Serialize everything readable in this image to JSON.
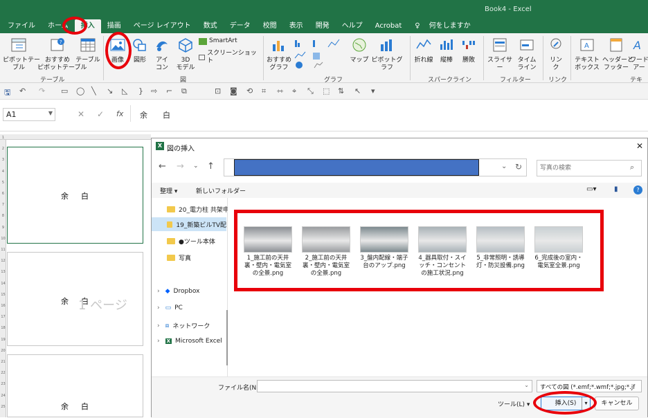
{
  "window": {
    "title": "Book4 - Excel"
  },
  "tabs": [
    "ファイル",
    "ホーム",
    "挿入",
    "描画",
    "ページ レイアウト",
    "数式",
    "データ",
    "校閲",
    "表示",
    "開発",
    "ヘルプ",
    "Acrobat",
    "何をしますか"
  ],
  "ribbon": {
    "pivot": "ピボットテー\nブル",
    "recommended_pivot": "おすすめ\nピボットテーブル",
    "table": "テーブル",
    "group_table": "テーブル",
    "picture": "画像",
    "shapes": "図形",
    "icons": "アイ\nコン",
    "models3d": "3D\nモデル",
    "smartart": "SmartArt",
    "screenshot": "スクリーンショット",
    "group_illust": "図",
    "rec_charts": "おすすめ\nグラフ",
    "maps": "マップ",
    "pivot_chart": "ピボットグラフ",
    "group_charts": "グラフ",
    "line": "折れ線",
    "column": "縦棒",
    "winloss": "勝敗",
    "group_spark": "スパークライン",
    "slicer": "スライサー",
    "timeline": "タイム\nライン",
    "group_filter": "フィルター",
    "link": "リン\nク",
    "group_link": "リンク",
    "textbox": "テキスト\nボックス",
    "header_footer": "ヘッダーと\nフッター",
    "wordart": "ワード\nアー",
    "group_text": "テキスト"
  },
  "formula_bar": {
    "name_box": "A1",
    "fx": "fx",
    "formula": "余　　白"
  },
  "sheet": {
    "rows": [
      "1",
      "2",
      "3",
      "4",
      "5",
      "6",
      "7",
      "8",
      "9",
      "10",
      "11",
      "12",
      "13",
      "14",
      "15",
      "16",
      "17",
      "18",
      "19",
      "20",
      "21",
      "22",
      "23",
      "24",
      "25"
    ],
    "margin_text": "余白",
    "page_watermark": "1 ページ"
  },
  "dialog": {
    "title": "図の挿入",
    "search_placeholder": "写真の検索",
    "organize": "整理 ▾",
    "new_folder": "新しいフォルダー",
    "tree": [
      {
        "label": "20_電力柱 共架申",
        "type": "folder"
      },
      {
        "label": "19_新築ビルTV配",
        "type": "folder",
        "selected": true
      },
      {
        "label": "●ツール本体",
        "type": "folder"
      },
      {
        "label": "写真",
        "type": "folder"
      },
      {
        "label": "Dropbox",
        "type": "dropbox"
      },
      {
        "label": "PC",
        "type": "pc"
      },
      {
        "label": "ネットワーク",
        "type": "network"
      },
      {
        "label": "Microsoft Excel",
        "type": "excel"
      }
    ],
    "files": [
      {
        "name": "1_施工前の天井裏・壁内・電気室の全景.png",
        "color": "#8b8f94"
      },
      {
        "name": "2_施工前の天井裏・壁内・電気室の全景.png",
        "color": "#9a9da0"
      },
      {
        "name": "3_盤内配線・端子台のアップ.png",
        "color": "#7d8a8f"
      },
      {
        "name": "4_器具取付・スイッチ・コンセントの施工状況.png",
        "color": "#a9b2b7"
      },
      {
        "name": "5_非常照明・誘導灯・防災設備.png",
        "color": "#b7bfc4"
      },
      {
        "name": "6_完成後の室内・電気室全景.png",
        "color": "#c9d0d3"
      }
    ],
    "filename_label": "ファイル名(N):",
    "filetype": "すべての図 (*.emf;*.wmf;*.jpg;*.jf",
    "tools": "ツール(L) ▾",
    "insert": "挿入(S)",
    "cancel": "キャンセル"
  }
}
